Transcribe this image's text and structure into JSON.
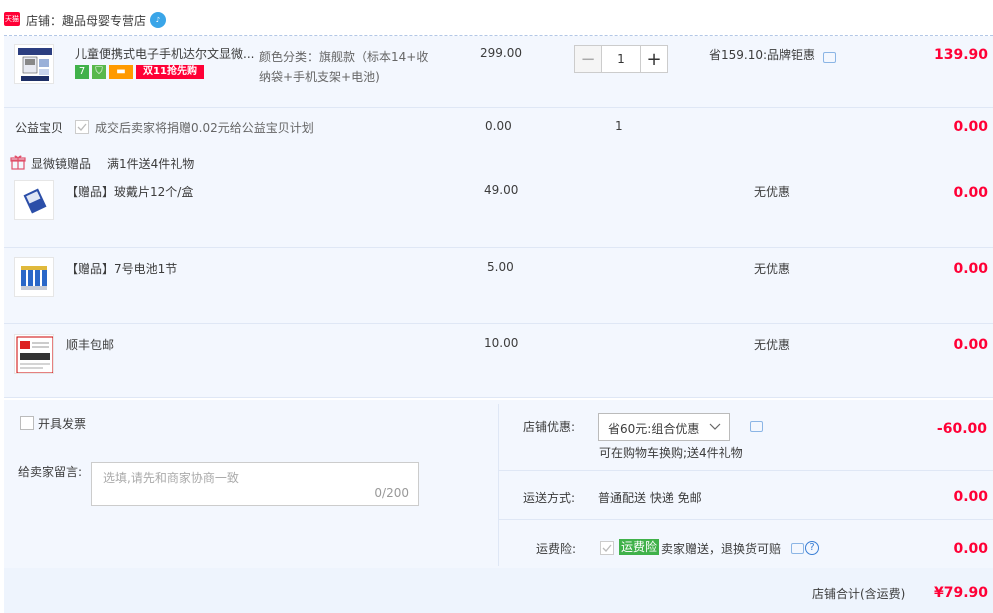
{
  "shop": {
    "badge": "天猫",
    "name_label": "店铺：",
    "name": "趣品母婴专营店"
  },
  "main_item": {
    "title": "儿童便携式电子手机达尔文显微...",
    "tags": [
      "7",
      "双11抢先购"
    ],
    "sku_label": "颜色分类：旗舰款（标本14+收",
    "sku_label_2": "纳袋+手机支架+电池)",
    "price": "299.00",
    "quantity": "1",
    "discount": "省159.10:品牌钜惠",
    "subtotal": "139.90"
  },
  "charity": {
    "label": "公益宝贝",
    "text": "成交后卖家将捐赠0.02元给公益宝贝计划",
    "price": "0.00",
    "quantity": "1",
    "subtotal": "0.00"
  },
  "gift_header": {
    "label": "显微镜赠品",
    "desc": "满1件送4件礼物"
  },
  "gifts": [
    {
      "title": "【赠品】玻戴片12个/盒",
      "price": "49.00",
      "discount": "无优惠",
      "subtotal": "0.00"
    },
    {
      "title": "【赠品】7号电池1节",
      "price": "5.00",
      "discount": "无优惠",
      "subtotal": "0.00"
    },
    {
      "title": "顺丰包邮",
      "price": "10.00",
      "discount": "无优惠",
      "subtotal": "0.00"
    }
  ],
  "invoice": {
    "label": "开具发票"
  },
  "message": {
    "label": "给卖家留言:",
    "placeholder": "选填,请先和商家协商一致",
    "counter": "0/200"
  },
  "store_discount": {
    "label": "店铺优惠:",
    "selected": "省60元:组合优惠",
    "note": "可在购物车换购;送4件礼物",
    "amount": "-60.00"
  },
  "shipping": {
    "label": "运送方式:",
    "value": "普通配送 快递 免邮",
    "amount": "0.00"
  },
  "insurance": {
    "label": "运费险:",
    "badge": "运费险",
    "text": "卖家赠送，退换货可赔",
    "amount": "0.00"
  },
  "total": {
    "label": "店铺合计(含运费)",
    "value": "¥79.90"
  },
  "colors": {
    "accent_red": "#ff0036",
    "panel_bg": "#f3f7fe",
    "tmall_red": "#ff0036",
    "green_badge": "#40b14a"
  }
}
